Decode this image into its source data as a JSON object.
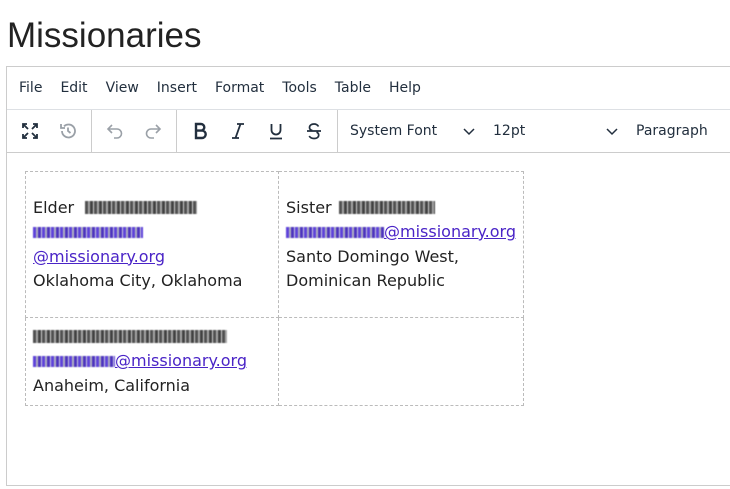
{
  "page": {
    "title": "Missionaries"
  },
  "menubar": {
    "items": [
      "File",
      "Edit",
      "View",
      "Insert",
      "Format",
      "Tools",
      "Table",
      "Help"
    ]
  },
  "toolbar": {
    "icons": [
      "fullscreen-icon",
      "history-icon",
      "undo-icon",
      "redo-icon",
      "bold-icon",
      "italic-icon",
      "underline-icon",
      "strikethrough-icon",
      "chevron-down-icon"
    ],
    "font_family": "System Font",
    "font_size": "12pt",
    "block_format": "Paragraph"
  },
  "table": {
    "cells": [
      {
        "prefix": "Elder",
        "email_domain": "@missionary.org",
        "location": "Oklahoma City, Oklahoma"
      },
      {
        "prefix": "Sister",
        "email_domain": "@missionary.org",
        "location_line1": "Santo Domingo West,",
        "location_line2": "Dominican Republic"
      },
      {
        "prefix": "",
        "email_domain": "@missionary.org",
        "location": "Anaheim, California"
      },
      {}
    ]
  },
  "colors": {
    "link": "#4a24c7",
    "text": "#222222",
    "border": "#cccccc"
  }
}
